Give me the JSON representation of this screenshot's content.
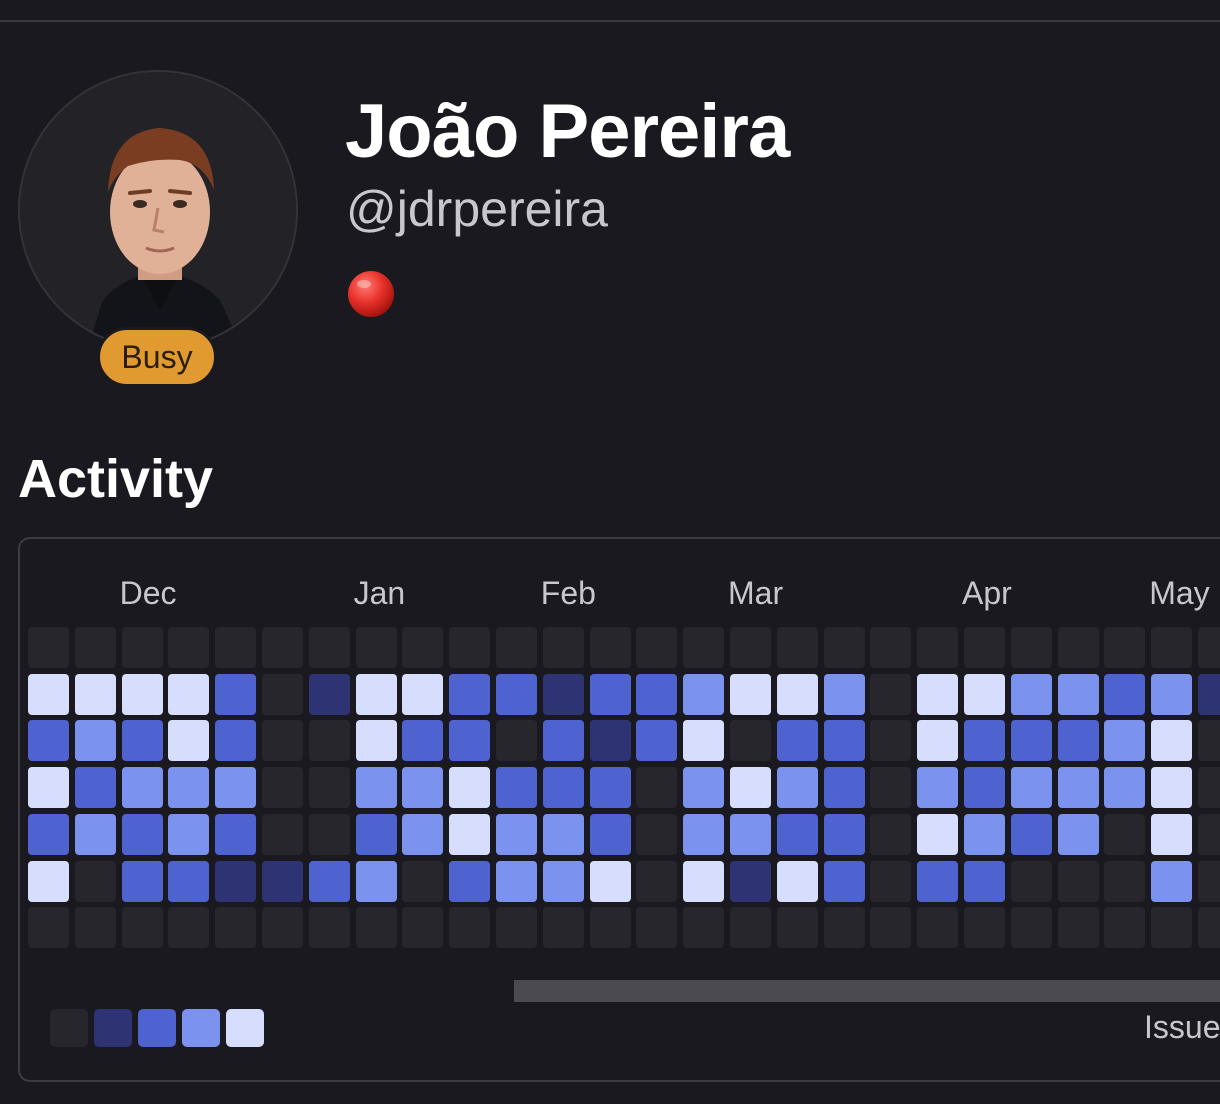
{
  "profile": {
    "name": "João Pereira",
    "handle": "@jdrpereira",
    "status_emoji": "red-circle-icon",
    "availability": "Busy",
    "colors": {
      "busy_badge": "#e09a2f",
      "status_dot": "#e8312b"
    }
  },
  "activity": {
    "title": "Activity",
    "months": [
      "Dec",
      "Jan",
      "Feb",
      "Mar",
      "Apr",
      "May"
    ],
    "filter_label": "Issue",
    "legend": {
      "levels": [
        0,
        1,
        2,
        3,
        4
      ],
      "colors": [
        "#27262c",
        "#2e3473",
        "#4e63cf",
        "#7b93ee",
        "#d7ddfc"
      ]
    },
    "columns": [
      {
        "month": "",
        "levels": [
          0,
          4,
          2,
          4,
          2,
          4,
          0
        ]
      },
      {
        "month": "",
        "levels": [
          0,
          4,
          3,
          2,
          3,
          0,
          0
        ]
      },
      {
        "month": "Dec",
        "levels": [
          0,
          4,
          2,
          3,
          2,
          2,
          0
        ]
      },
      {
        "month": "",
        "levels": [
          0,
          4,
          4,
          3,
          3,
          2,
          0
        ]
      },
      {
        "month": "",
        "levels": [
          0,
          2,
          2,
          3,
          2,
          1,
          0
        ]
      },
      {
        "month": "",
        "levels": [
          0,
          0,
          0,
          0,
          0,
          1,
          0
        ]
      },
      {
        "month": "",
        "levels": [
          0,
          1,
          0,
          0,
          0,
          2,
          0
        ]
      },
      {
        "month": "Jan",
        "levels": [
          0,
          4,
          4,
          3,
          2,
          3,
          0
        ]
      },
      {
        "month": "",
        "levels": [
          0,
          4,
          2,
          3,
          3,
          0,
          0
        ]
      },
      {
        "month": "",
        "levels": [
          0,
          2,
          2,
          4,
          4,
          2,
          0
        ]
      },
      {
        "month": "",
        "levels": [
          0,
          2,
          0,
          2,
          3,
          3,
          0
        ]
      },
      {
        "month": "Feb",
        "levels": [
          0,
          1,
          2,
          2,
          3,
          3,
          0
        ]
      },
      {
        "month": "",
        "levels": [
          0,
          2,
          1,
          2,
          2,
          4,
          0
        ]
      },
      {
        "month": "",
        "levels": [
          0,
          2,
          2,
          0,
          0,
          0,
          0
        ]
      },
      {
        "month": "",
        "levels": [
          0,
          3,
          4,
          3,
          3,
          4,
          0
        ]
      },
      {
        "month": "Mar",
        "levels": [
          0,
          4,
          0,
          4,
          3,
          1,
          0
        ]
      },
      {
        "month": "",
        "levels": [
          0,
          4,
          2,
          3,
          2,
          4,
          0
        ]
      },
      {
        "month": "",
        "levels": [
          0,
          3,
          2,
          2,
          2,
          2,
          0
        ]
      },
      {
        "month": "",
        "levels": [
          0,
          0,
          0,
          0,
          0,
          0,
          0
        ]
      },
      {
        "month": "",
        "levels": [
          0,
          4,
          4,
          3,
          4,
          2,
          0
        ]
      },
      {
        "month": "Apr",
        "levels": [
          0,
          4,
          2,
          2,
          3,
          2,
          0
        ]
      },
      {
        "month": "",
        "levels": [
          0,
          3,
          2,
          3,
          2,
          0,
          0
        ]
      },
      {
        "month": "",
        "levels": [
          0,
          3,
          2,
          3,
          3,
          0,
          0
        ]
      },
      {
        "month": "",
        "levels": [
          0,
          2,
          3,
          3,
          0,
          0,
          0
        ]
      },
      {
        "month": "May",
        "levels": [
          0,
          3,
          4,
          4,
          4,
          3,
          0
        ]
      },
      {
        "month": "",
        "levels": [
          0,
          1,
          0,
          0,
          0,
          0,
          0
        ]
      }
    ]
  }
}
